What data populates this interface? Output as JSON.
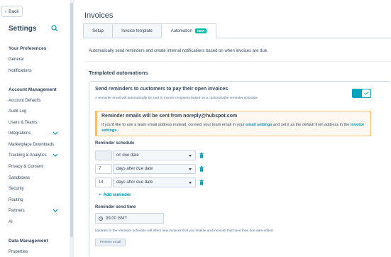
{
  "sidebar": {
    "back_label": "Back",
    "title": "Settings",
    "sections": [
      {
        "heading": "Your Preferences",
        "items": [
          "General",
          "Notifications"
        ]
      },
      {
        "heading": "Account Management",
        "items": [
          "Account Defaults",
          "Audit Log",
          "Users & Teams",
          "Integrations",
          "Marketplace Downloads",
          "Tracking & Analytics",
          "Privacy & Consent",
          "Sandboxes",
          "Security",
          "Routing",
          "Partners",
          "AI"
        ]
      },
      {
        "heading": "Data Management",
        "items": [
          "Properties"
        ]
      }
    ]
  },
  "page": {
    "title": "Invoices",
    "tabs": [
      {
        "label": "Setup"
      },
      {
        "label": "Invoice template"
      },
      {
        "label": "Automation",
        "badge": "NEW"
      }
    ],
    "intro": "Automatically send reminders and create internal notifications based on when invoices are due.",
    "section_title": "Templated automations"
  },
  "card": {
    "title": "Send reminders to customers to pay their open invoices",
    "subtitle": "A reminder email will automatically be sent to invoice recipients based on a customizable reminder schedule",
    "toggle_on": true,
    "callout": {
      "title": "Reminder emails will be sent from noreply@hubspot.com",
      "body_1": "If you'd like to use a team email address instead, connect your team email in your ",
      "link_1": "email settings",
      "body_2": " and set it as the default from address in the ",
      "link_2": "invoice settings",
      "body_3": "."
    },
    "schedule_label": "Reminder schedule",
    "schedule": [
      {
        "days": "",
        "option": "on due date"
      },
      {
        "days": "7",
        "option": "days after due date"
      },
      {
        "days": "14",
        "option": "days after due date"
      }
    ],
    "add_reminder": "Add reminder",
    "send_time_label": "Reminder send time",
    "send_time": "09:00 GMT",
    "note": "Updates to the reminder schedule will affect new invoices that you finalize and invoices that have their due date edited.",
    "preview_button": "Preview email"
  },
  "colors": {
    "accent": "#00a4bd",
    "link": "#0091ae",
    "badge": "#00bda5",
    "callout_border": "#f5c26b"
  }
}
